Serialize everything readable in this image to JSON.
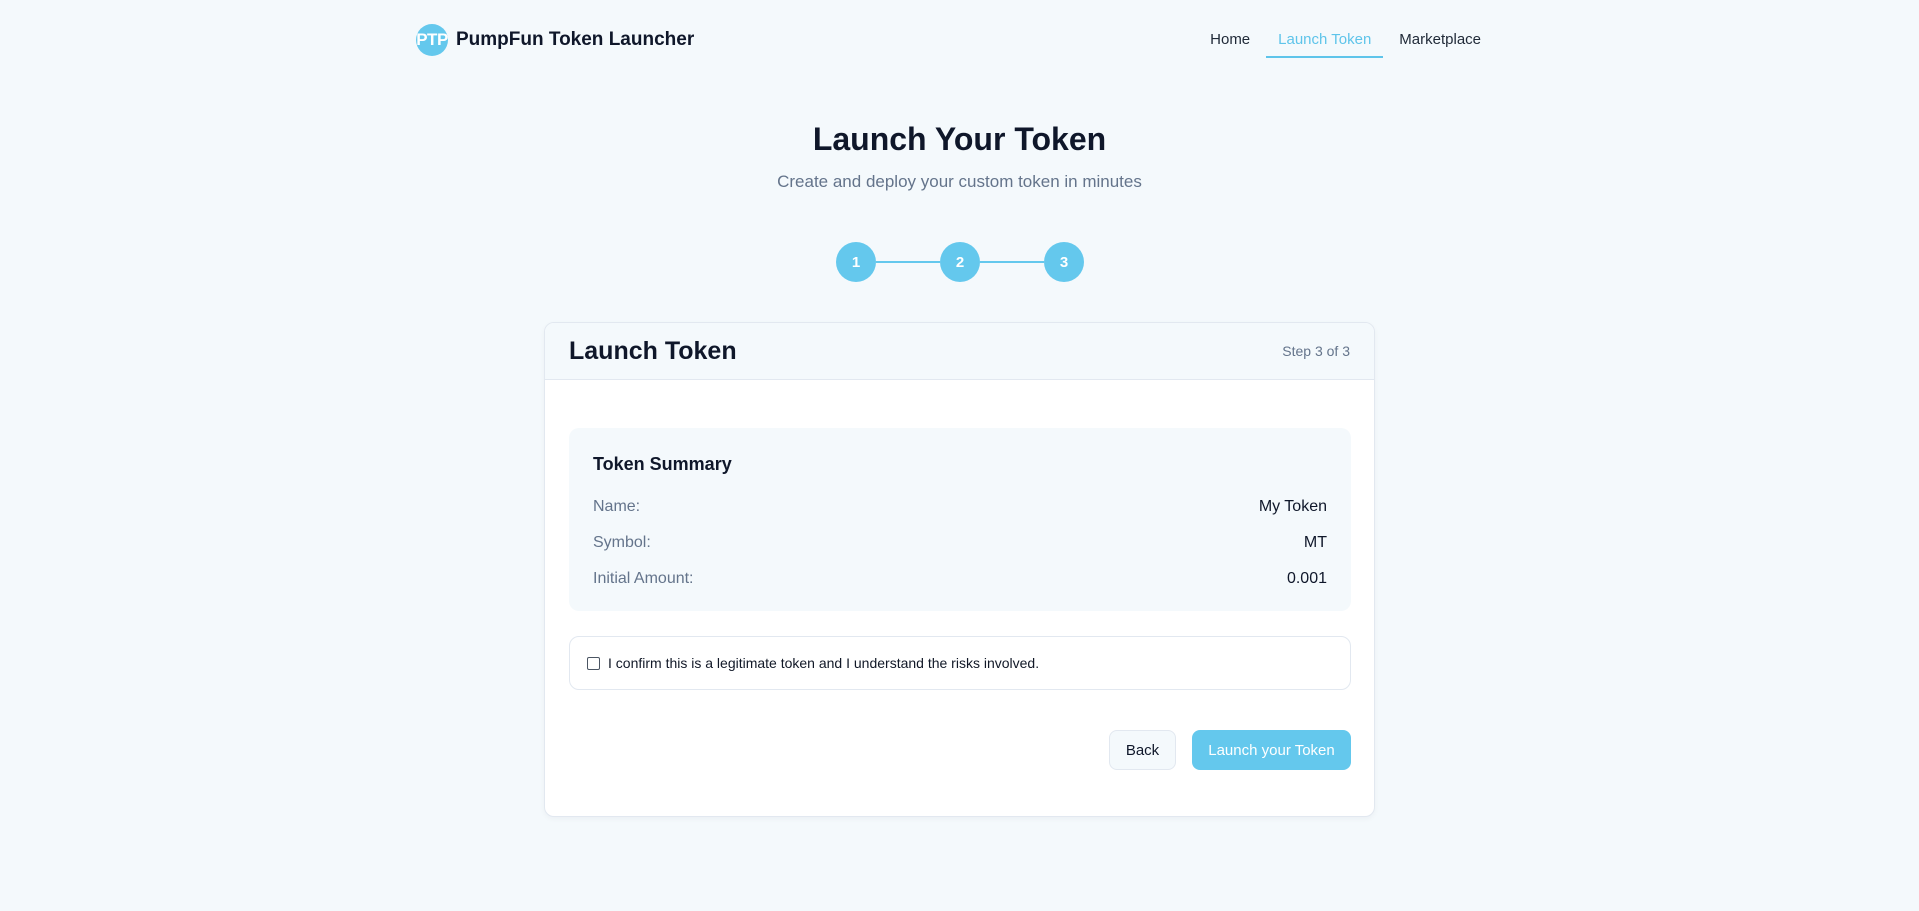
{
  "header": {
    "logo_text": "PTP",
    "brand_name": "PumpFun Token Launcher",
    "nav": [
      {
        "label": "Home"
      },
      {
        "label": "Launch Token"
      },
      {
        "label": "Marketplace"
      }
    ],
    "active_nav": "Launch Token"
  },
  "hero": {
    "title": "Launch Your Token",
    "subtitle": "Create and deploy your custom token in minutes"
  },
  "stepper": {
    "steps": [
      "1",
      "2",
      "3"
    ],
    "current": 3
  },
  "card": {
    "title": "Launch Token",
    "step_label": "Step 3 of 3",
    "summary": {
      "title": "Token Summary",
      "rows": [
        {
          "label": "Name:",
          "value": "My Token"
        },
        {
          "label": "Symbol:",
          "value": "MT"
        },
        {
          "label": "Initial Amount:",
          "value": "0.001"
        }
      ]
    },
    "confirm": {
      "checked": false,
      "text": "I confirm this is a legitimate token and I understand the risks involved."
    },
    "buttons": {
      "back": "Back",
      "launch": "Launch your Token"
    }
  },
  "colors": {
    "accent": "#64c8ed",
    "background": "#f4f9fc",
    "text": "#0f172a",
    "muted": "#64748b"
  }
}
